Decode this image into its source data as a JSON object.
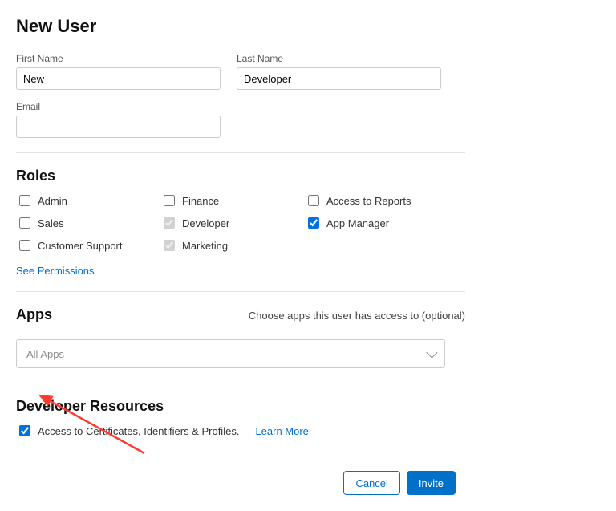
{
  "title": "New User",
  "fields": {
    "firstName": {
      "label": "First Name",
      "value": "New"
    },
    "lastName": {
      "label": "Last Name",
      "value": "Developer"
    },
    "email": {
      "label": "Email",
      "value": ""
    }
  },
  "roles": {
    "heading": "Roles",
    "items": {
      "admin": {
        "label": "Admin",
        "checked": false,
        "locked": false
      },
      "finance": {
        "label": "Finance",
        "checked": false,
        "locked": false
      },
      "reports": {
        "label": "Access to Reports",
        "checked": false,
        "locked": false
      },
      "sales": {
        "label": "Sales",
        "checked": false,
        "locked": false
      },
      "developer": {
        "label": "Developer",
        "checked": true,
        "locked": true
      },
      "appmgr": {
        "label": "App Manager",
        "checked": true,
        "locked": false
      },
      "support": {
        "label": "Customer Support",
        "checked": false,
        "locked": false
      },
      "marketing": {
        "label": "Marketing",
        "checked": true,
        "locked": true
      }
    },
    "seePermissions": "See Permissions"
  },
  "apps": {
    "heading": "Apps",
    "subtitle": "Choose apps this user has access to (optional)",
    "placeholder": "All Apps"
  },
  "devResources": {
    "heading": "Developer Resources",
    "checkbox": {
      "label": "Access to Certificates, Identifiers & Profiles.",
      "checked": true
    },
    "learnMore": "Learn More"
  },
  "buttons": {
    "cancel": "Cancel",
    "invite": "Invite"
  }
}
